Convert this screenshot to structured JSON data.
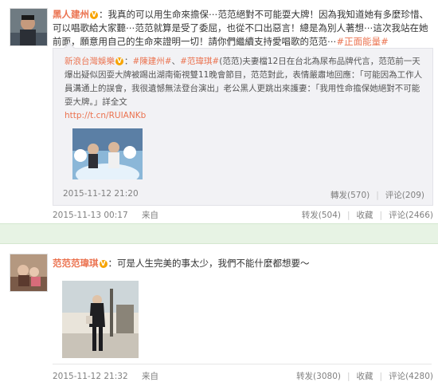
{
  "post1": {
    "author": "黑人建州",
    "text": "：我真的可以用生命來擔保⋯范范絕對不可能耍大牌！因為我知道她有多麼珍惜、可以唱歌給大家聽⋯范范就算是受了委屈，也從不口出惡言！總是為別人著想⋯這次我站在她前面，願意用自己的生命來證明一切！請你們繼續支持愛唱歌的范范⋯",
    "topic": "#正面能量#",
    "repost": {
      "source": "新浪台灣娛樂",
      "at1": "#陳建州#",
      "at2": "#范瑋琪#",
      "body": "(范范)夫妻檔12日在台北為尿布品牌代言，范范前一天爆出疑似因耍大牌被踢出湖南衛視雙11晚會節目，范范對此，表情嚴肅地回應：「可能因為工作人員溝通上的誤會，我很遺憾無法登台演出」老公黑人更跳出來護妻：「我用性命擔保她絕對不可能耍大牌。」詳全文",
      "url": "http://t.cn/RUIANKb",
      "time": "2015-11-12 21:20",
      "repost_label": "轉发(570)",
      "comment_label": "评论(209)"
    },
    "time": "2015-11-13 00:17",
    "source_label": "来自",
    "repost_label": "转发(504)",
    "fav_label": "收藏",
    "comment_label": "评论(2466)"
  },
  "post2": {
    "author": "范范范瑋琪",
    "text": "：可是人生完美的事太少，我們不能什麼都想要～",
    "time": "2015-11-12 21:32",
    "source_label": "来自",
    "repost_label": "转发(3080)",
    "fav_label": "收藏",
    "comment_label": "评论(4280)"
  },
  "colors": {
    "accent": "#eb7350",
    "band": "#e7f3e4"
  }
}
